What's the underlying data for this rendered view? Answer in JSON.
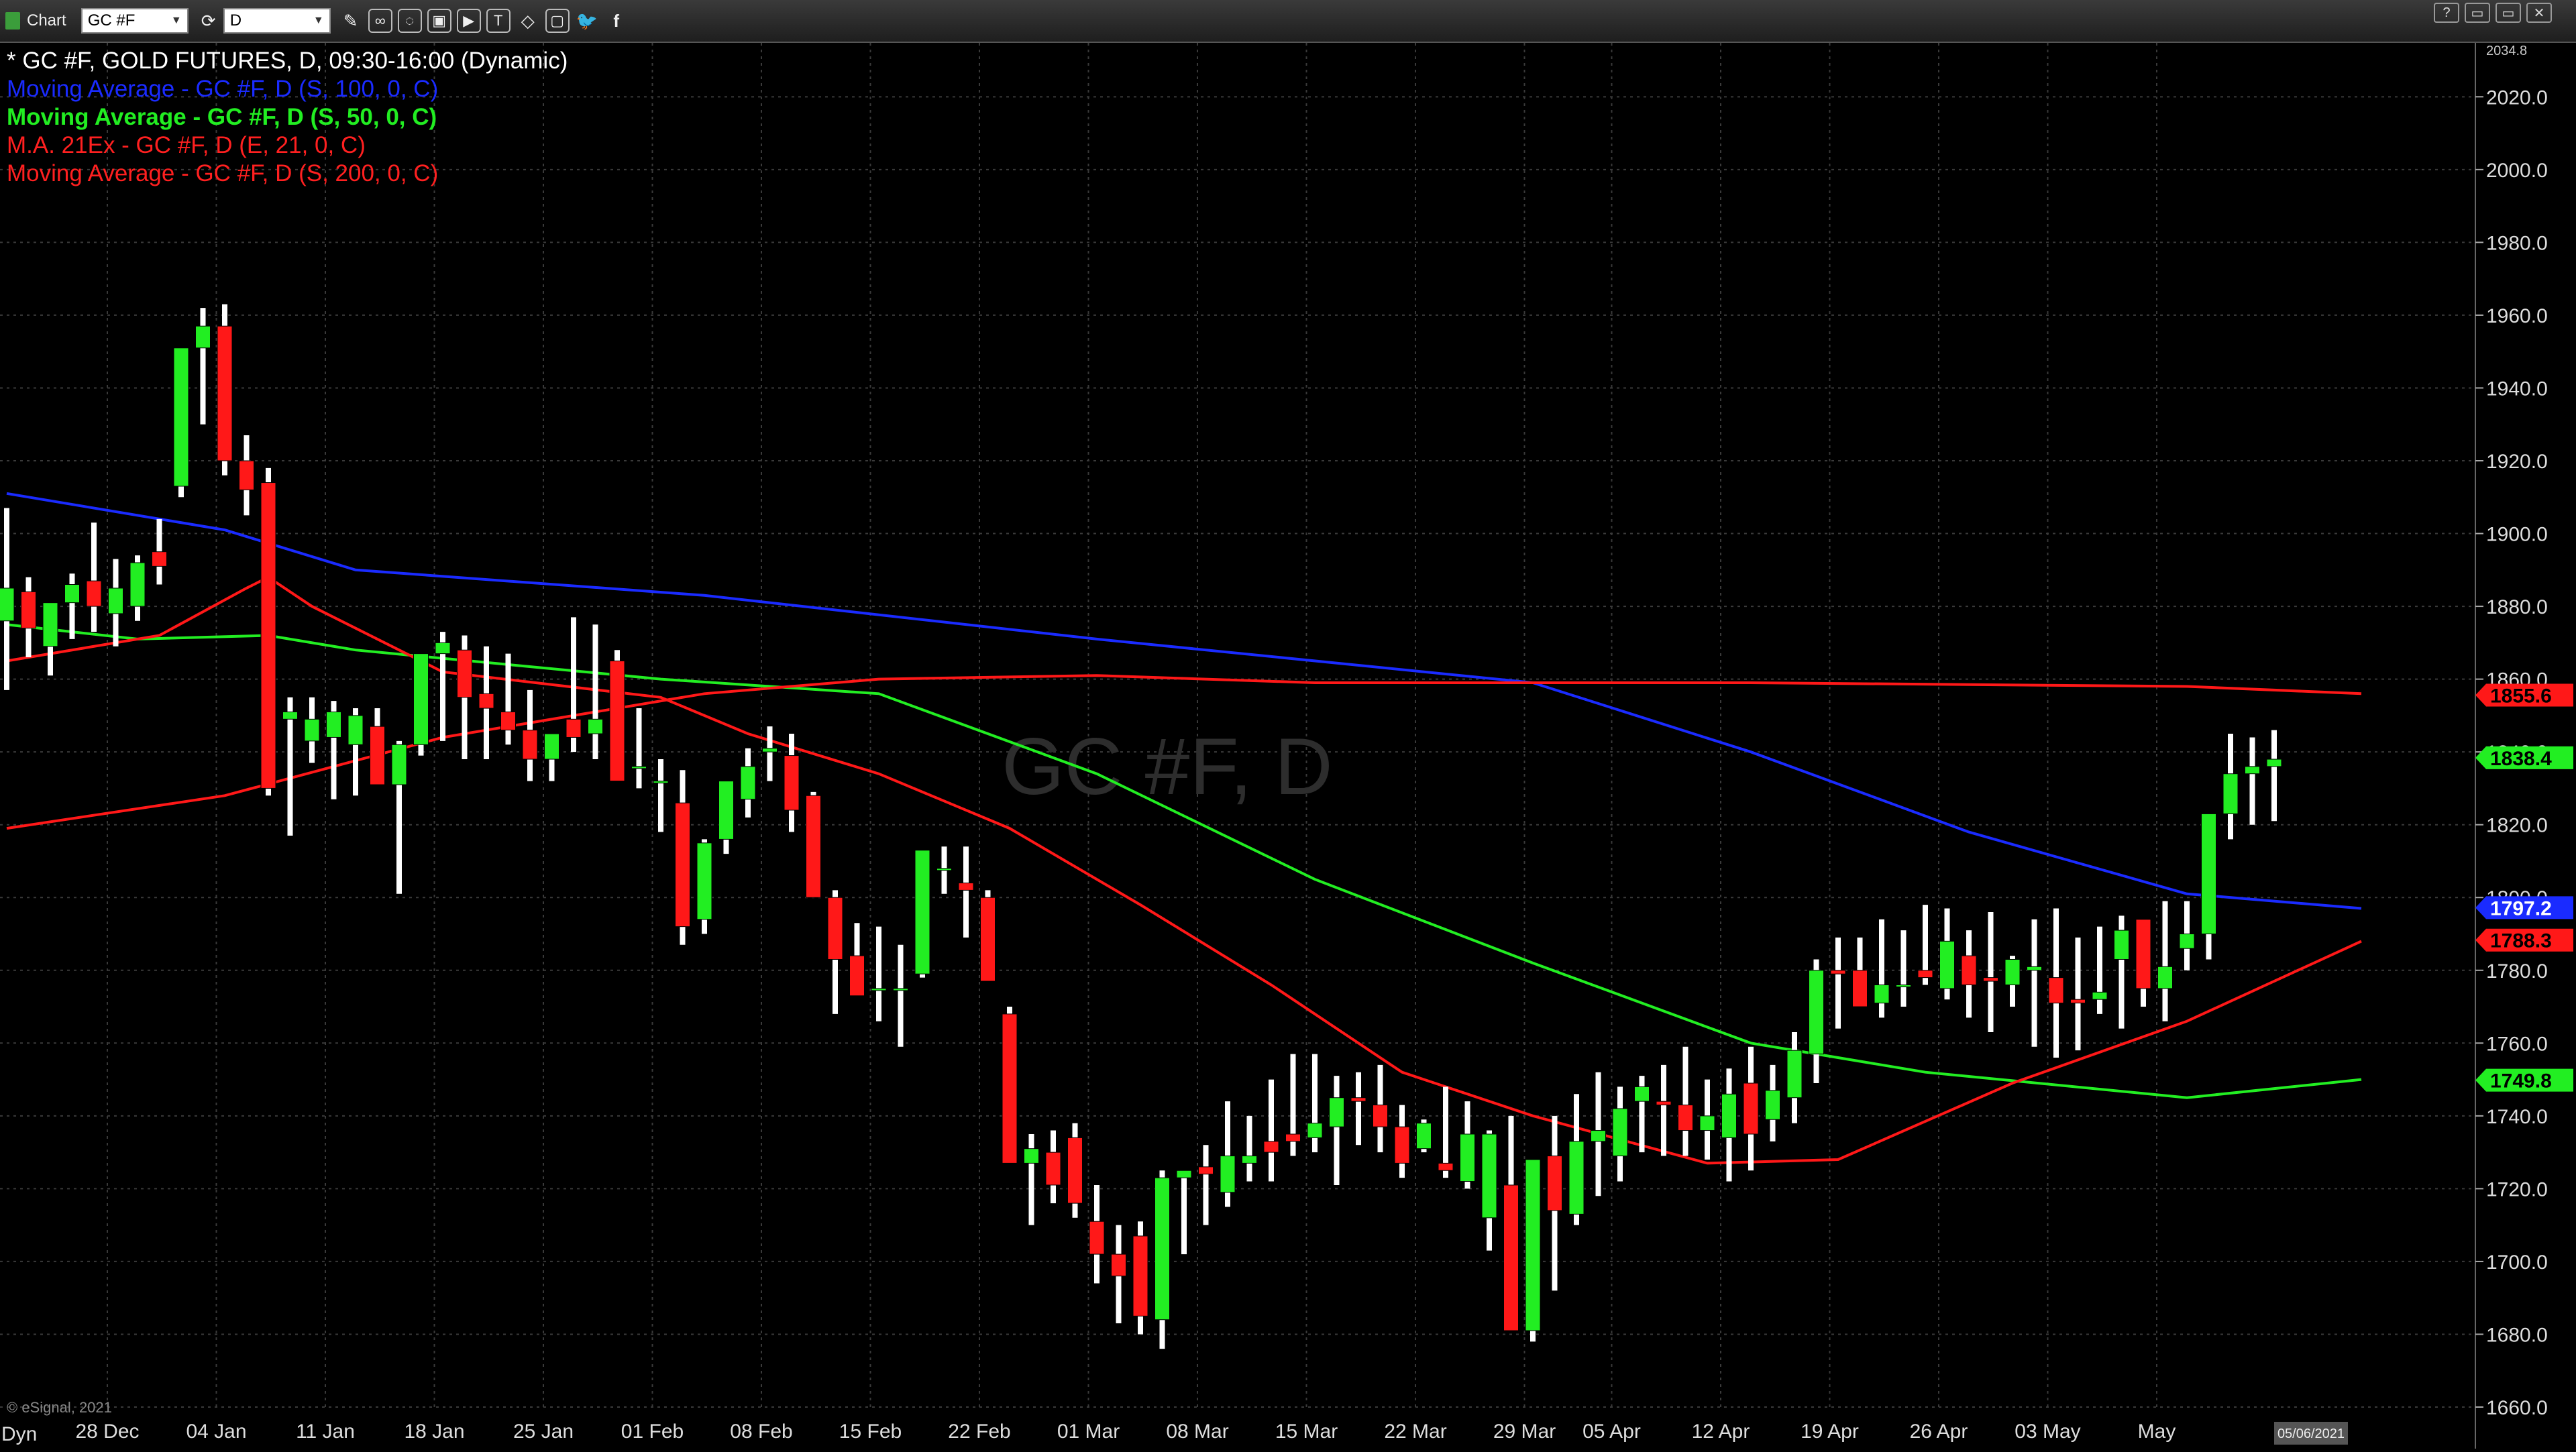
{
  "toolbar": {
    "title": "Chart",
    "symbol_value": "GC #F",
    "interval_value": "D",
    "icons": [
      "pencil-icon",
      "link-icon",
      "chat-icon",
      "image-icon",
      "play-icon",
      "text-icon",
      "shapes-icon",
      "chat-bubble-icon",
      "twitter-icon",
      "facebook-icon"
    ],
    "window_controls": [
      "?",
      "▭",
      "▭",
      "✕"
    ]
  },
  "legend": [
    {
      "text": "* GC #F, GOLD FUTURES, D, 09:30-16:00 (Dynamic)",
      "color": "#ffffff"
    },
    {
      "text": "Moving Average - GC #F, D (S, 100, 0, C)",
      "color": "#1a2bff"
    },
    {
      "text": "Moving Average - GC #F, D (S, 50, 0, C)",
      "color": "#22ee22"
    },
    {
      "text": "M.A. 21Ex - GC #F, D (E, 21, 0, C)",
      "color": "#ff2020"
    },
    {
      "text": "Moving Average - GC #F, D (S, 200, 0, C)",
      "color": "#ff2020"
    }
  ],
  "watermark": "GC #F, D",
  "copyright": "© eSignal, 2021",
  "dyn_label": "Dyn",
  "colors": {
    "up": "#22ee22",
    "down": "#ff1818",
    "ma100": "#1a2bff",
    "ma50": "#22ee22",
    "ema21": "#ff1818",
    "ma200": "#ff1818",
    "grid": "#3a3a3a"
  },
  "chart_data": {
    "type": "candlestick",
    "title": "* GC #F, GOLD FUTURES, D, 09:30-16:00 (Dynamic)",
    "ylim": [
      1660,
      2034.8
    ],
    "y_ticks": [
      1660,
      1680,
      1700,
      1720,
      1740,
      1760,
      1780,
      1800,
      1820,
      1840,
      1860,
      1880,
      1900,
      1920,
      1940,
      1960,
      1980,
      2000,
      2020
    ],
    "y_top_label": "2034.8",
    "x_labels": [
      "28 Dec",
      "04 Jan",
      "11 Jan",
      "18 Jan",
      "25 Jan",
      "01 Feb",
      "08 Feb",
      "15 Feb",
      "22 Feb",
      "01 Mar",
      "08 Mar",
      "15 Mar",
      "22 Mar",
      "29 Mar",
      "05 Apr",
      "12 Apr",
      "19 Apr",
      "26 Apr",
      "03 May",
      "May"
    ],
    "cursor_date": "05/06/2021",
    "price_tags": [
      {
        "value": 1855.6,
        "label": "1855.6",
        "color": "#ff1818"
      },
      {
        "value": 1838.4,
        "label": "1838.4",
        "color": "#22ee22"
      },
      {
        "value": 1797.2,
        "label": "1797.2",
        "color": "#1a2bff"
      },
      {
        "value": 1788.3,
        "label": "1788.3",
        "color": "#ff1818"
      },
      {
        "value": 1749.8,
        "label": "1749.8",
        "color": "#22ee22"
      }
    ],
    "candles": [
      [
        1876,
        1907,
        1857,
        1885
      ],
      [
        1884,
        1888,
        1866,
        1874
      ],
      [
        1869,
        1878,
        1861,
        1881
      ],
      [
        1881,
        1889,
        1871,
        1886
      ],
      [
        1887,
        1903,
        1873,
        1880
      ],
      [
        1878,
        1893,
        1869,
        1885
      ],
      [
        1880,
        1894,
        1876,
        1892
      ],
      [
        1895,
        1904,
        1886,
        1891
      ],
      [
        1913,
        1950,
        1910,
        1951
      ],
      [
        1951,
        1962,
        1930,
        1957
      ],
      [
        1957,
        1963,
        1916,
        1920
      ],
      [
        1920,
        1927,
        1905,
        1912
      ],
      [
        1914,
        1918,
        1828,
        1830
      ],
      [
        1849,
        1855,
        1817,
        1851
      ],
      [
        1843,
        1855,
        1837,
        1849
      ],
      [
        1844,
        1854,
        1827,
        1851
      ],
      [
        1842,
        1852,
        1828,
        1850
      ],
      [
        1847,
        1852,
        1833,
        1831
      ],
      [
        1831,
        1843,
        1801,
        1842
      ],
      [
        1842,
        1867,
        1839,
        1867
      ],
      [
        1867,
        1873,
        1843,
        1870
      ],
      [
        1868,
        1872,
        1838,
        1855
      ],
      [
        1856,
        1869,
        1838,
        1852
      ],
      [
        1851,
        1867,
        1842,
        1846
      ],
      [
        1846,
        1857,
        1832,
        1838
      ],
      [
        1838,
        1845,
        1832,
        1845
      ],
      [
        1849,
        1877,
        1840,
        1844
      ],
      [
        1845,
        1875,
        1838,
        1849
      ],
      [
        1865,
        1868,
        1832,
        1832
      ],
      [
        1836,
        1852,
        1830,
        1836
      ],
      [
        1832,
        1838,
        1818,
        1832
      ],
      [
        1826,
        1835,
        1787,
        1792
      ],
      [
        1794,
        1816,
        1790,
        1815
      ],
      [
        1816,
        1831,
        1812,
        1832
      ],
      [
        1827,
        1841,
        1822,
        1836
      ],
      [
        1840,
        1847,
        1832,
        1841
      ],
      [
        1839,
        1845,
        1818,
        1824
      ],
      [
        1828,
        1829,
        1802,
        1800
      ],
      [
        1800,
        1802,
        1768,
        1783
      ],
      [
        1784,
        1793,
        1780,
        1773
      ],
      [
        1775,
        1792,
        1766,
        1775
      ],
      [
        1775,
        1787,
        1759,
        1775
      ],
      [
        1779,
        1813,
        1778,
        1813
      ],
      [
        1808,
        1814,
        1801,
        1808
      ],
      [
        1804,
        1814,
        1789,
        1802
      ],
      [
        1800,
        1802,
        1777,
        1777
      ],
      [
        1768,
        1770,
        1731,
        1727
      ],
      [
        1727,
        1735,
        1710,
        1731
      ],
      [
        1730,
        1736,
        1716,
        1721
      ],
      [
        1734,
        1738,
        1712,
        1716
      ],
      [
        1711,
        1721,
        1694,
        1702
      ],
      [
        1702,
        1710,
        1683,
        1696
      ],
      [
        1707,
        1711,
        1680,
        1685
      ],
      [
        1684,
        1725,
        1676,
        1723
      ],
      [
        1723,
        1725,
        1702,
        1725
      ],
      [
        1726,
        1732,
        1710,
        1724
      ],
      [
        1719,
        1744,
        1715,
        1729
      ],
      [
        1727,
        1740,
        1722,
        1729
      ],
      [
        1733,
        1750,
        1722,
        1730
      ],
      [
        1735,
        1757,
        1729,
        1733
      ],
      [
        1734,
        1757,
        1730,
        1738
      ],
      [
        1737,
        1751,
        1721,
        1745
      ],
      [
        1745,
        1752,
        1732,
        1744
      ],
      [
        1743,
        1754,
        1730,
        1737
      ],
      [
        1737,
        1743,
        1723,
        1727
      ],
      [
        1731,
        1739,
        1730,
        1738
      ],
      [
        1727,
        1748,
        1723,
        1725
      ],
      [
        1722,
        1744,
        1720,
        1735
      ],
      [
        1712,
        1736,
        1703,
        1735
      ],
      [
        1721,
        1740,
        1682,
        1681
      ],
      [
        1681,
        1723,
        1678,
        1728
      ],
      [
        1729,
        1740,
        1692,
        1714
      ],
      [
        1713,
        1746,
        1710,
        1733
      ],
      [
        1733,
        1752,
        1718,
        1736
      ],
      [
        1729,
        1748,
        1722,
        1742
      ],
      [
        1744,
        1751,
        1730,
        1748
      ],
      [
        1744,
        1754,
        1729,
        1743
      ],
      [
        1743,
        1759,
        1729,
        1736
      ],
      [
        1736,
        1750,
        1728,
        1740
      ],
      [
        1734,
        1753,
        1722,
        1746
      ],
      [
        1749,
        1759,
        1725,
        1735
      ],
      [
        1739,
        1754,
        1733,
        1747
      ],
      [
        1745,
        1763,
        1738,
        1758
      ],
      [
        1757,
        1783,
        1749,
        1780
      ],
      [
        1780,
        1789,
        1764,
        1779
      ],
      [
        1780,
        1789,
        1774,
        1770
      ],
      [
        1771,
        1794,
        1767,
        1776
      ],
      [
        1776,
        1791,
        1770,
        1776
      ],
      [
        1780,
        1798,
        1776,
        1778
      ],
      [
        1775,
        1797,
        1772,
        1788
      ],
      [
        1784,
        1791,
        1767,
        1776
      ],
      [
        1778,
        1796,
        1763,
        1777
      ],
      [
        1776,
        1784,
        1770,
        1783
      ],
      [
        1780,
        1794,
        1759,
        1781
      ],
      [
        1778,
        1797,
        1756,
        1771
      ],
      [
        1772,
        1789,
        1758,
        1771
      ],
      [
        1772,
        1792,
        1768,
        1774
      ],
      [
        1783,
        1795,
        1764,
        1791
      ],
      [
        1794,
        1794,
        1770,
        1775
      ],
      [
        1775,
        1799,
        1766,
        1781
      ],
      [
        1786,
        1799,
        1780,
        1790
      ],
      [
        1790,
        1795,
        1783,
        1823
      ],
      [
        1823,
        1845,
        1816,
        1834
      ],
      [
        1834,
        1844,
        1820,
        1836
      ],
      [
        1836,
        1846,
        1821,
        1838
      ]
    ],
    "series": [
      {
        "name": "Moving Average - GC #F, D (S, 100, 0, C)",
        "color": "#1a2bff",
        "points": [
          [
            0,
            1911
          ],
          [
            10,
            1901
          ],
          [
            16,
            1890
          ],
          [
            32,
            1883
          ],
          [
            50,
            1871
          ],
          [
            70,
            1859
          ],
          [
            80,
            1840
          ],
          [
            90,
            1818
          ],
          [
            100,
            1801
          ],
          [
            108,
            1797
          ]
        ]
      },
      {
        "name": "Moving Average - GC #F, D (S, 50, 0, C)",
        "color": "#22ee22",
        "points": [
          [
            0,
            1875
          ],
          [
            6,
            1871
          ],
          [
            12,
            1872
          ],
          [
            16,
            1868
          ],
          [
            30,
            1860
          ],
          [
            40,
            1856
          ],
          [
            50,
            1834
          ],
          [
            60,
            1805
          ],
          [
            70,
            1782
          ],
          [
            80,
            1760
          ],
          [
            88,
            1752
          ],
          [
            100,
            1745
          ],
          [
            108,
            1750
          ]
        ]
      },
      {
        "name": "M.A. 21Ex - GC #F, D (E, 21, 0, C)",
        "color": "#ff1818",
        "points": [
          [
            0,
            1865
          ],
          [
            7,
            1872
          ],
          [
            11,
            1885
          ],
          [
            12,
            1888
          ],
          [
            14,
            1880
          ],
          [
            20,
            1862
          ],
          [
            30,
            1855
          ],
          [
            34,
            1845
          ],
          [
            40,
            1834
          ],
          [
            46,
            1819
          ],
          [
            52,
            1798
          ],
          [
            58,
            1776
          ],
          [
            64,
            1752
          ],
          [
            70,
            1740
          ],
          [
            78,
            1727
          ],
          [
            84,
            1728
          ],
          [
            92,
            1749
          ],
          [
            100,
            1766
          ],
          [
            108,
            1788
          ]
        ]
      },
      {
        "name": "Moving Average - GC #F, D (S, 200, 0, C)",
        "color": "#ff1818",
        "points": [
          [
            0,
            1819
          ],
          [
            10,
            1828
          ],
          [
            20,
            1844
          ],
          [
            32,
            1856
          ],
          [
            40,
            1860
          ],
          [
            50,
            1861
          ],
          [
            60,
            1859
          ],
          [
            80,
            1859
          ],
          [
            100,
            1858
          ],
          [
            108,
            1856
          ]
        ]
      }
    ]
  }
}
